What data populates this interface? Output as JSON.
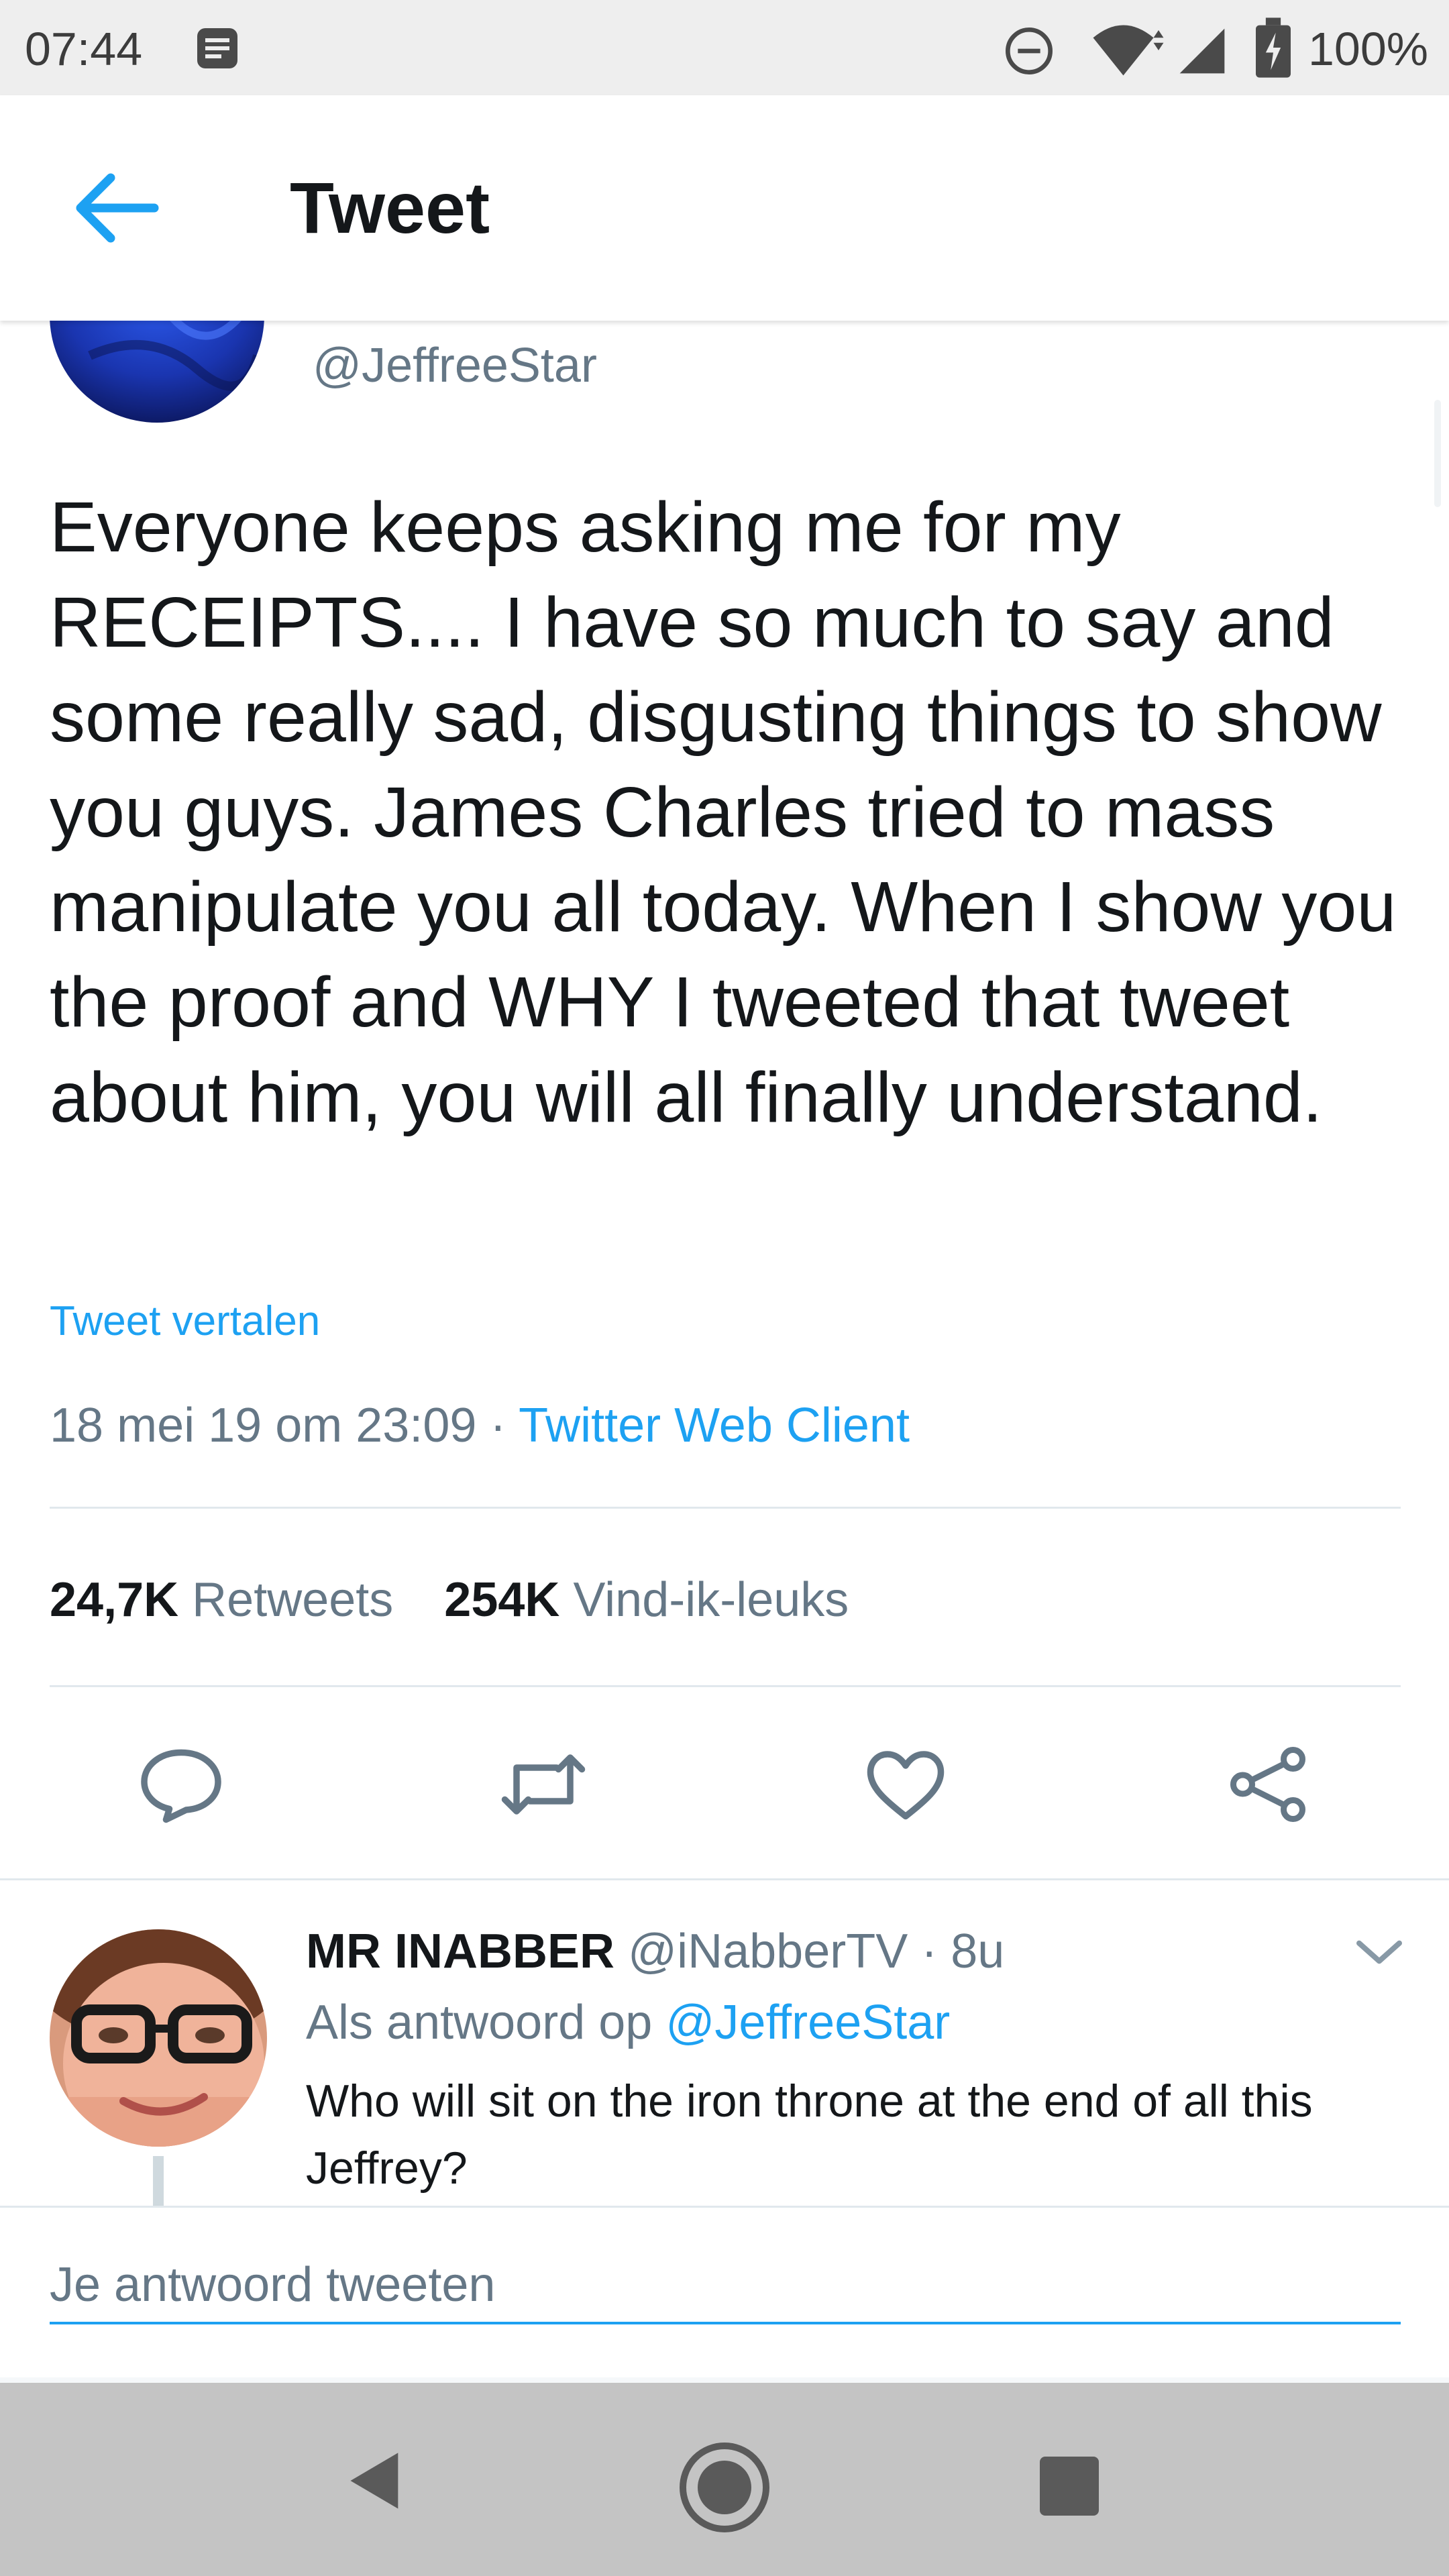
{
  "status_bar": {
    "time": "07:44",
    "battery": "100%",
    "icons": [
      "notification-icon",
      "do-not-disturb-icon",
      "wifi-icon",
      "signal-icon",
      "battery-icon"
    ]
  },
  "header": {
    "title": "Tweet",
    "back_icon": "arrow-left-icon"
  },
  "tweet": {
    "handle": "@JeffreeStar",
    "text": "Everyone keeps asking me for my RECEIPTS.... I have so much to say and some really sad, disgusting things to show you guys. James Charles tried to mass manipulate you all today. When I show you the proof and WHY I tweeted that tweet about him, you will all finally understand.",
    "translate_label": "Tweet vertalen",
    "timestamp": "18 mei 19 om 23:09",
    "separator": " · ",
    "source": "Twitter Web Client",
    "retweet_count": "24,7K",
    "retweet_label": "Retweets",
    "like_count": "254K",
    "like_label": "Vind-ik-leuks"
  },
  "actions": [
    "reply-icon",
    "retweet-icon",
    "heart-icon",
    "share-icon"
  ],
  "reply": {
    "name": "MR INABBER",
    "handle": "@iNabberTV",
    "time": "· 8u",
    "context_prefix": "Als antwoord op",
    "context_mention": "@JeffreeStar",
    "text": "Who will sit on the iron throne at the end of all this Jeffrey?"
  },
  "compose": {
    "placeholder": "Je antwoord tweeten"
  },
  "colors": {
    "accent": "#1da1f2",
    "text_primary": "#14171a",
    "text_secondary": "#657786",
    "divider": "#e1e8ed"
  }
}
